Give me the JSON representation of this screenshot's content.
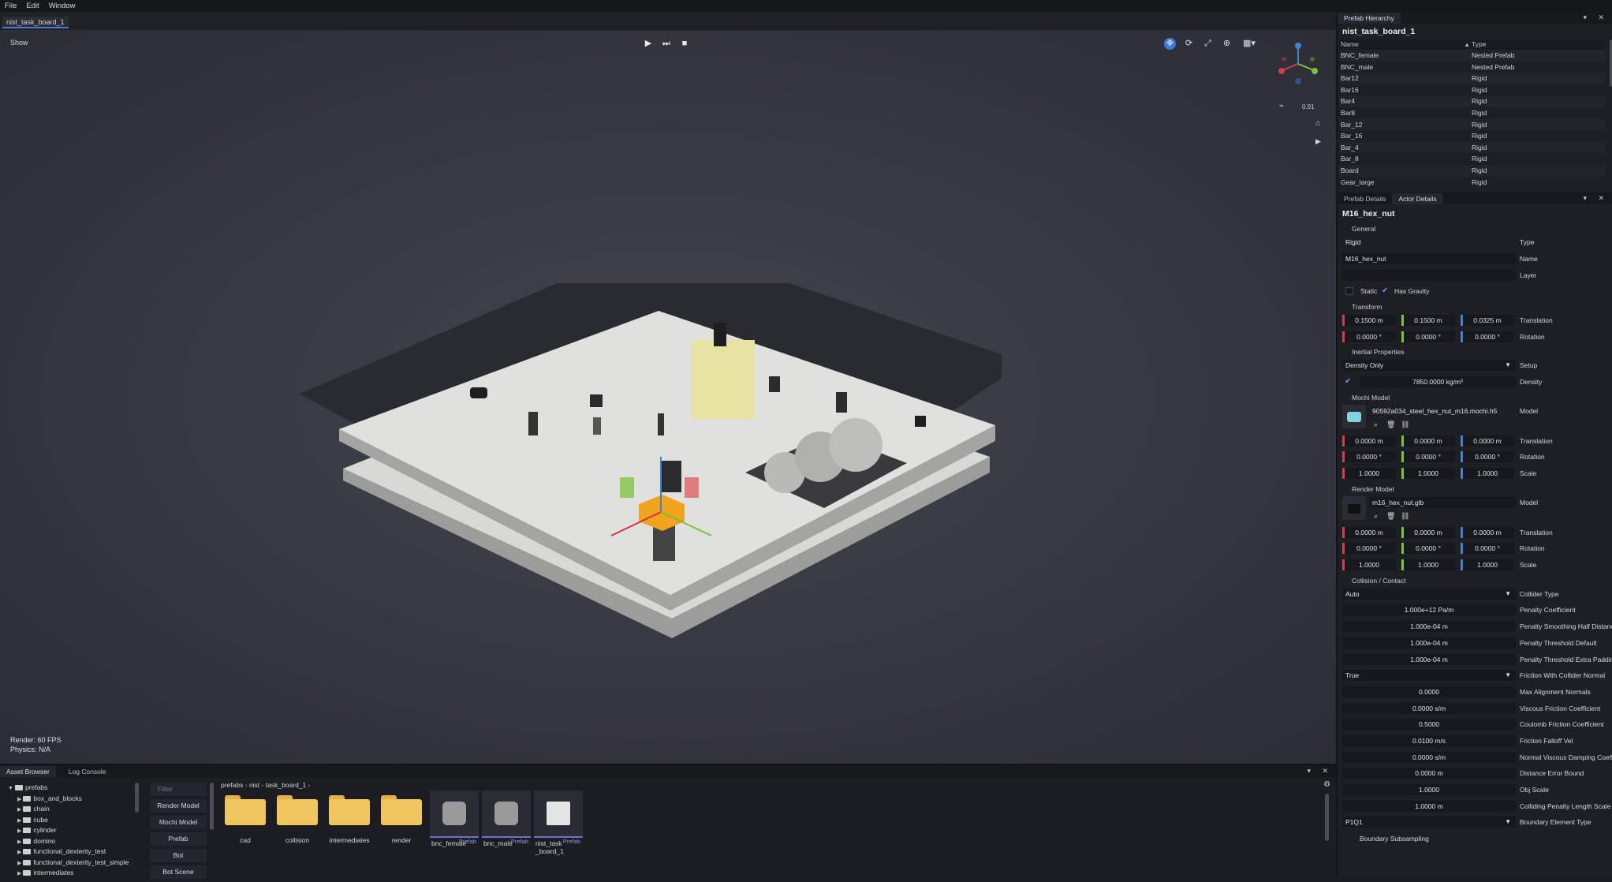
{
  "menu": [
    "File",
    "Edit",
    "Window"
  ],
  "doc_tab": "nist_task_board_1",
  "viewport": {
    "show_label": "Show",
    "zoom_value": "0.91",
    "render_fps": "Render:  60 FPS",
    "physics": "Physics: N/A"
  },
  "hierarchy": {
    "tab": "Prefab Hierarchy",
    "title": "nist_task_board_1",
    "col_name": "Name",
    "col_type": "Type",
    "rows": [
      [
        "BNC_female",
        "Nested Prefab"
      ],
      [
        "BNC_male",
        "Nested Prefab"
      ],
      [
        "Bar12",
        "Rigid"
      ],
      [
        "Bar16",
        "Rigid"
      ],
      [
        "Bar4",
        "Rigid"
      ],
      [
        "Bar8",
        "Rigid"
      ],
      [
        "Bar_12",
        "Rigid"
      ],
      [
        "Bar_16",
        "Rigid"
      ],
      [
        "Bar_4",
        "Rigid"
      ],
      [
        "Bar_8",
        "Rigid"
      ],
      [
        "Board",
        "Rigid"
      ],
      [
        "Gear_large",
        "Rigid"
      ]
    ]
  },
  "details": {
    "tab1": "Prefab Details",
    "tab2": "Actor Details",
    "title": "M16_hex_nut",
    "general": "General",
    "type_val": "Rigid",
    "type_lbl": "Type",
    "name_val": "M16_hex_nut",
    "name_lbl": "Name",
    "layer_lbl": "Layer",
    "static_lbl": "Static",
    "gravity_lbl": "Has Gravity",
    "transform": "Transform",
    "tx": "0.1500 m",
    "ty": "0.1500 m",
    "tz": "0.0325 m",
    "translation": "Translation",
    "rx": "0.0000 °",
    "ry": "0.0000 °",
    "rz": "0.0000 °",
    "rotation": "Rotation",
    "inertial": "Inertial Properties",
    "setup_val": "Density Only",
    "setup_lbl": "Setup",
    "density_val": "7850.0000 kg/m³",
    "density_lbl": "Density",
    "mochi": "Mochi Model",
    "mochi_file": "90592a034_steel_hex_nut_m16.mochi.h5",
    "model_lbl": "Model",
    "mt_x": "0.0000 m",
    "mt_y": "0.0000 m",
    "mt_z": "0.0000 m",
    "mr_x": "0.0000 °",
    "mr_y": "0.0000 °",
    "mr_z": "0.0000 °",
    "ms_x": "1.0000",
    "ms_y": "1.0000",
    "ms_z": "1.0000",
    "scale": "Scale",
    "render_model": "Render Model",
    "render_file": "m16_hex_nut.glb",
    "rt_x": "0.0000 m",
    "rt_y": "0.0000 m",
    "rt_z": "0.0000 m",
    "rr_x": "0.0000 °",
    "rr_y": "0.0000 °",
    "rr_z": "0.0000 °",
    "rs_x": "1.0000",
    "rs_y": "1.0000",
    "rs_z": "1.0000",
    "collision": "Collision / Contact",
    "props": [
      [
        "Auto",
        "Collider Type",
        true
      ],
      [
        "1.000e+12 Pa/m",
        "Penalty Coefficient",
        false
      ],
      [
        "1.000e-04 m",
        "Penalty Smoothing Half Distance",
        false
      ],
      [
        "1.000e-04 m",
        "Penalty Threshold Default",
        false
      ],
      [
        "1.000e-04 m",
        "Penalty Threshold Extra Padding",
        false
      ],
      [
        "True",
        "Friction With Collider Normal",
        true
      ],
      [
        "0.0000",
        "Max Alignment Normals",
        false
      ],
      [
        "0.0000 s/m",
        "Viscous Friction Coefficient",
        false
      ],
      [
        "0.5000",
        "Coulomb Friction Coefficient",
        false
      ],
      [
        "0.0100 m/s",
        "Friction Falloff Vel",
        false
      ],
      [
        "0.0000 s/m",
        "Normal Viscous Damping Coefficient",
        false
      ],
      [
        "0.0000 m",
        "Distance Error Bound",
        false
      ],
      [
        "1.0000",
        "Obj Scale",
        false
      ],
      [
        "1.0000 m",
        "Colliding Penalty Length Scale",
        false
      ],
      [
        "P1Q1",
        "Boundary Element Type",
        true
      ]
    ],
    "boundary_sub": "Boundary Subsampling"
  },
  "bottom": {
    "tab1": "Asset Browser",
    "tab2": "Log Console",
    "tree": [
      [
        "prefabs",
        0
      ],
      [
        "box_and_blocks",
        1
      ],
      [
        "chain",
        1
      ],
      [
        "cube",
        1
      ],
      [
        "cylinder",
        1
      ],
      [
        "domino",
        1
      ],
      [
        "functional_dexterity_test",
        1
      ],
      [
        "functional_dexterity_test_simple",
        1
      ],
      [
        "intermediates",
        1
      ]
    ],
    "filter_placeholder": "Filter",
    "filters": [
      "Render Model",
      "Mochi Model",
      "Prefab",
      "Bot",
      "Bot Scene"
    ],
    "breadcrumb": [
      "prefabs",
      "nist",
      "task_board_1"
    ],
    "folders": [
      "cad",
      "collision",
      "intermediates",
      "render"
    ],
    "prefabs": [
      "bnc_female",
      "bnc_male",
      "nist_task\n_board_1"
    ],
    "prefab_tag": "Prefab"
  }
}
